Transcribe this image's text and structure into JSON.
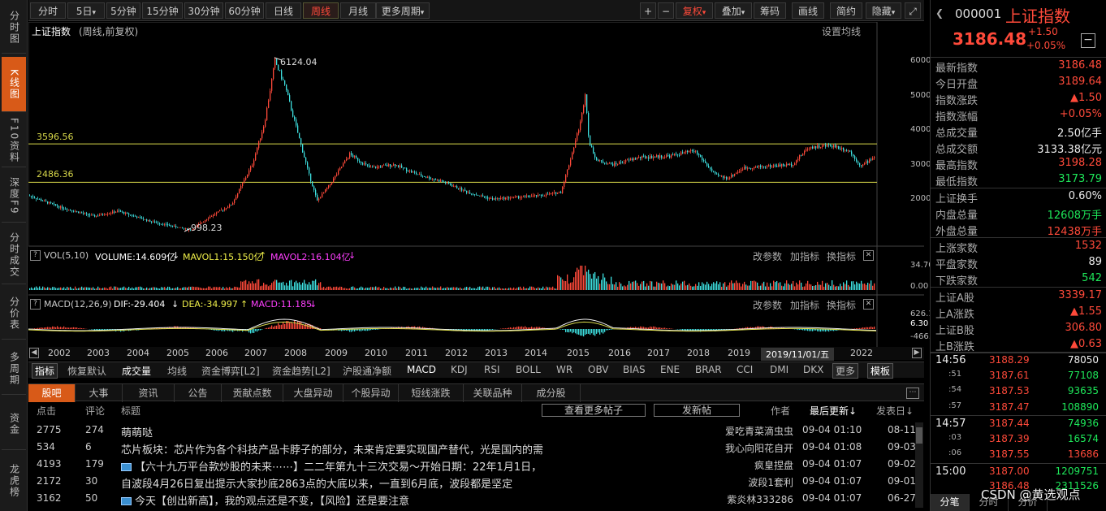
{
  "leftnav": [
    "分时图",
    "K线图",
    "F10资料",
    "深度F9",
    "分时成交",
    "分价表",
    "多周期",
    "资金",
    "龙虎榜"
  ],
  "toolbar": {
    "left": [
      "分时",
      "5日",
      "5分钟",
      "15分钟",
      "30分钟",
      "60分钟",
      "日线",
      "周线",
      "月线",
      "更多周期"
    ],
    "dropdown_marks": [
      "▾",
      "▾"
    ],
    "active": "周线",
    "right": [
      "+",
      "−",
      "复权",
      "叠加",
      "筹码",
      "画线",
      "简约",
      "隐藏"
    ],
    "right_dropdown_mark": "▾",
    "expand_icon": "⤢"
  },
  "chart": {
    "title": "上证指数",
    "subtitle": "(周线,前复权)",
    "settings": "设置均线",
    "high_label": "6124.04",
    "low_label": "998.23",
    "line1_label": "3596.56",
    "line2_label": "2486.36",
    "line1_value": 3596.56,
    "line2_value": 2486.36,
    "yticks": [
      "6000.00",
      "5000.00",
      "4000.00",
      "3000.00",
      "2000.00"
    ],
    "vol_yticks": [
      "34.70",
      "0.00"
    ],
    "macd_yticks": [
      "626.18",
      "6.30",
      "-466.00"
    ]
  },
  "vol_legend": {
    "q": "?",
    "name": "VOL(5,10)",
    "volume": "VOLUME:14.609亿",
    "vol_arrow": "↓",
    "ma1": "MAVOL1:15.150亿",
    "ma1_arrow": "↑",
    "ma2": "MAVOL2:16.104亿",
    "ma2_arrow": "↓",
    "actions": [
      "改参数",
      "加指标",
      "换指标"
    ],
    "close": "✕"
  },
  "macd_legend": {
    "q": "?",
    "name": "MACD(12,26,9)",
    "dif": "DIF:-29.404",
    "dif_arrow": "↓",
    "dea": "DEA:-34.997",
    "dea_arrow": "↑",
    "macd": "MACD:11.185",
    "macd_arrow": "↓",
    "actions": [
      "改参数",
      "加指标",
      "换指标"
    ],
    "close": "✕"
  },
  "xaxis": {
    "years": [
      "2002",
      "2003",
      "2004",
      "2005",
      "2006",
      "2007",
      "2008",
      "2009",
      "2010",
      "2011",
      "2012",
      "2013",
      "2014",
      "2015",
      "2016",
      "2017",
      "2018",
      "2019",
      "2022"
    ],
    "cursor_date": "2019/11/01/五",
    "left": "◀",
    "right": "▶"
  },
  "indicators": [
    "指标",
    "恢复默认",
    "成交量",
    "均线",
    "资金博弈[L2]",
    "资金趋势[L2]",
    "沪股通净额",
    "MACD",
    "KDJ",
    "RSI",
    "BOLL",
    "WR",
    "OBV",
    "BIAS",
    "ENE",
    "BRAR",
    "CCI",
    "DMI",
    "DKX",
    "更多",
    "模板"
  ],
  "news": {
    "tabs": [
      "股吧",
      "大事",
      "资讯",
      "公告",
      "贡献点数",
      "大盘异动",
      "个股异动",
      "短线涨跌",
      "关联品种",
      "成分股"
    ],
    "more_icon": "⋯",
    "head": {
      "clicks": "点击",
      "comments": "评论",
      "title": "标题",
      "more_btn": "查看更多帖子",
      "post_btn": "发新帖",
      "author": "作者",
      "updated": "最后更新↓",
      "posted": "发表日↓"
    },
    "rows": [
      {
        "clicks": "2775",
        "comments": "274",
        "title": "萌萌哒",
        "icon": false,
        "author": "爱吃青菜滴虫虫",
        "updated": "09-04 01:10",
        "posted": "08-11"
      },
      {
        "clicks": "534",
        "comments": "6",
        "title": "芯片板块：芯片作为各个科技产品卡脖子的部分，未来肯定要实现国产替代，光是国内的需",
        "icon": false,
        "author": "我心向阳花自开",
        "updated": "09-04 01:08",
        "posted": "09-03"
      },
      {
        "clicks": "4193",
        "comments": "179",
        "title": "【六十九万平台款炒股的未来⋯⋯】二二年第九十三次交易～开始日期：22年1月1日，",
        "icon": true,
        "author": "疯皇捏盘",
        "updated": "09-04 01:07",
        "posted": "09-02"
      },
      {
        "clicks": "2172",
        "comments": "30",
        "title": "自波段4月26日复出提示大家抄底2863点的大底以来，一直到6月底，波段都是坚定",
        "icon": false,
        "author": "波段1套利",
        "updated": "09-04 01:07",
        "posted": "09-01"
      },
      {
        "clicks": "3162",
        "comments": "50",
        "title": "今天【创出新高】，我的观点还是不变，【风险】还是要注意",
        "icon": true,
        "author": "紫炎林333286",
        "updated": "09-04 01:07",
        "posted": "06-27"
      }
    ]
  },
  "quote": {
    "code": "000001",
    "name": "上证指数",
    "price": "3186.48",
    "change": "+1.50",
    "pct": "+0.05%",
    "minus_icon": "−",
    "fields": [
      {
        "k": "最新指数",
        "v": "3186.48",
        "c": "red"
      },
      {
        "k": "今日开盘",
        "v": "3189.64",
        "c": "red"
      },
      {
        "k": "指数涨跌",
        "v": "▲1.50",
        "c": "red"
      },
      {
        "k": "指数涨幅",
        "v": "+0.05%",
        "c": "red"
      },
      {
        "k": "总成交量",
        "v": "2.50亿手",
        "c": "wht"
      },
      {
        "k": "总成交额",
        "v": "3133.38亿元",
        "c": "wht"
      },
      {
        "k": "最高指数",
        "v": "3198.28",
        "c": "red"
      },
      {
        "k": "最低指数",
        "v": "3173.79",
        "c": "grn"
      }
    ],
    "fields2": [
      {
        "k": "上证换手",
        "v": "0.60%",
        "c": "wht"
      },
      {
        "k": "内盘总量",
        "v": "12608万手",
        "c": "grn"
      },
      {
        "k": "外盘总量",
        "v": "12438万手",
        "c": "red"
      }
    ],
    "fields3": [
      {
        "k": "上涨家数",
        "v": "1532",
        "c": "red"
      },
      {
        "k": "平盘家数",
        "v": "89",
        "c": "wht"
      },
      {
        "k": "下跌家数",
        "v": "542",
        "c": "grn"
      }
    ],
    "fields4": [
      {
        "k": "上证A股",
        "v": "3339.17",
        "c": "red"
      },
      {
        "k": "上A涨跌",
        "v": "▲1.55",
        "c": "red"
      },
      {
        "k": "上证B股",
        "v": "306.80",
        "c": "red"
      },
      {
        "k": "上B涨跌",
        "v": "▲0.63",
        "c": "red"
      }
    ],
    "ticks": [
      {
        "t": "14:56",
        "p": "3188.29",
        "v": "78050",
        "vc": "wht",
        "big": true
      },
      {
        "t": ":51",
        "p": "3187.61",
        "v": "77108",
        "vc": "grn"
      },
      {
        "t": ":54",
        "p": "3187.53",
        "v": "93635",
        "vc": "grn"
      },
      {
        "t": ":57",
        "p": "3187.47",
        "v": "108890",
        "vc": "grn"
      },
      {
        "t": "14:57",
        "p": "3187.44",
        "v": "74936",
        "vc": "grn",
        "big": true
      },
      {
        "t": ":03",
        "p": "3187.39",
        "v": "16574",
        "vc": "grn"
      },
      {
        "t": ":06",
        "p": "3187.55",
        "v": "13686",
        "vc": "red"
      },
      {
        "t": "15:00",
        "p": "3187.00",
        "v": "1209751",
        "vc": "grn",
        "big": true
      },
      {
        "t": "",
        "p": "3186.48",
        "v": "2311526",
        "vc": "grn"
      }
    ],
    "bottom_tabs": [
      "分笔",
      "分时",
      "分价"
    ],
    "watermark": "CSDN @黄选观点"
  },
  "colors": {
    "up": "#ff4a3a",
    "down": "#1ee85a",
    "accent": "#d85a18",
    "line": "#d8d84a"
  }
}
